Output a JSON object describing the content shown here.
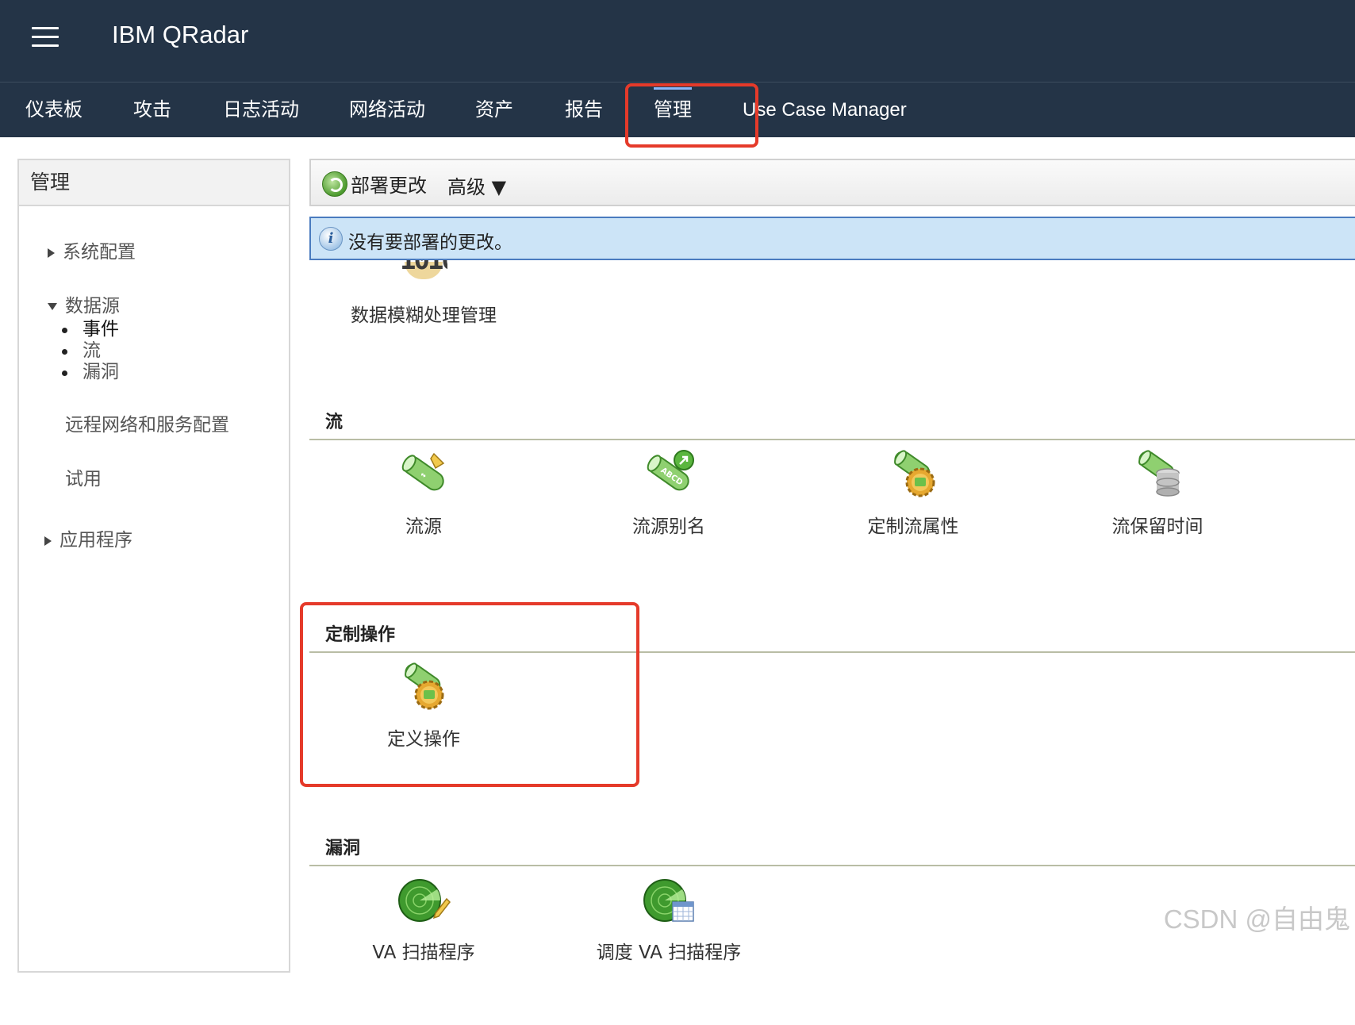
{
  "app": {
    "title": "IBM QRadar"
  },
  "nav": {
    "tabs": [
      {
        "label": "仪表板"
      },
      {
        "label": "攻击"
      },
      {
        "label": "日志活动"
      },
      {
        "label": "网络活动"
      },
      {
        "label": "资产"
      },
      {
        "label": "报告"
      },
      {
        "label": "管理",
        "active": true
      },
      {
        "label": "Use Case Manager"
      }
    ]
  },
  "sidebar": {
    "title": "管理",
    "items": {
      "system_config": "系统配置",
      "data_sources": "数据源",
      "data_source_children": [
        "事件",
        "流",
        "漏洞"
      ],
      "remote_network": "远程网络和服务配置",
      "trial": "试用",
      "apps": "应用程序"
    }
  },
  "toolbar": {
    "deploy_label": "部署更改",
    "advanced_label": "高级 ▼"
  },
  "info": {
    "message": "没有要部署的更改。"
  },
  "partial_tile": {
    "label": "数据模糊处理管理"
  },
  "sections": {
    "flows": {
      "title": "流",
      "tiles": [
        {
          "label": "流源",
          "icon": "flow-source-icon"
        },
        {
          "label": "流源别名",
          "icon": "flow-source-alias-icon"
        },
        {
          "label": "定制流属性",
          "icon": "custom-flow-property-icon"
        },
        {
          "label": "流保留时间",
          "icon": "flow-retention-icon"
        }
      ]
    },
    "custom_actions": {
      "title": "定制操作",
      "tiles": [
        {
          "label": "定义操作",
          "icon": "define-action-icon"
        }
      ]
    },
    "vulnerabilities": {
      "title": "漏洞",
      "tiles": [
        {
          "label": "VA 扫描程序",
          "icon": "va-scanner-icon"
        },
        {
          "label": "调度 VA 扫描程序",
          "icon": "schedule-va-scanner-icon"
        }
      ]
    }
  },
  "watermark": {
    "text": "CSDN @自由鬼"
  },
  "colors": {
    "header_bg": "#243447",
    "highlight": "#e53a2a",
    "info_bg": "#cce4f7"
  }
}
